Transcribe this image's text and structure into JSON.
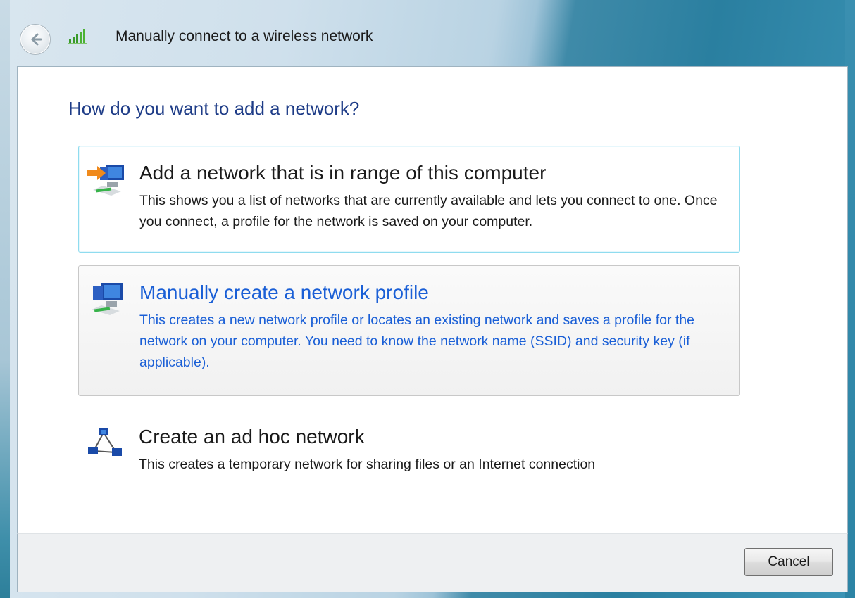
{
  "window": {
    "title": "Manually connect to a wireless network",
    "back_icon": "back-arrow-icon",
    "network_icon": "wireless-signal-icon"
  },
  "main": {
    "heading": "How do you want to add a network?",
    "options": [
      {
        "title": "Add a network that is in range of this computer",
        "description": "This shows you a list of networks that are currently available and lets you connect to one. Once you connect, a profile for the network is saved on your computer.",
        "icon": "network-add-icon"
      },
      {
        "title": "Manually create a network profile",
        "description": "This creates a new network profile or locates an existing network and saves a profile for the network on your computer. You need to know the network name (SSID) and security key (if applicable).",
        "icon": "network-profile-icon"
      },
      {
        "title": "Create an ad hoc network",
        "description": "This creates a temporary network for sharing files or an Internet connection",
        "icon": "ad-hoc-network-icon"
      }
    ]
  },
  "footer": {
    "cancel_label": "Cancel"
  },
  "colors": {
    "heading": "#1e3c87",
    "link_blue": "#1a5fd6",
    "hover_border": "#8fdcef"
  }
}
